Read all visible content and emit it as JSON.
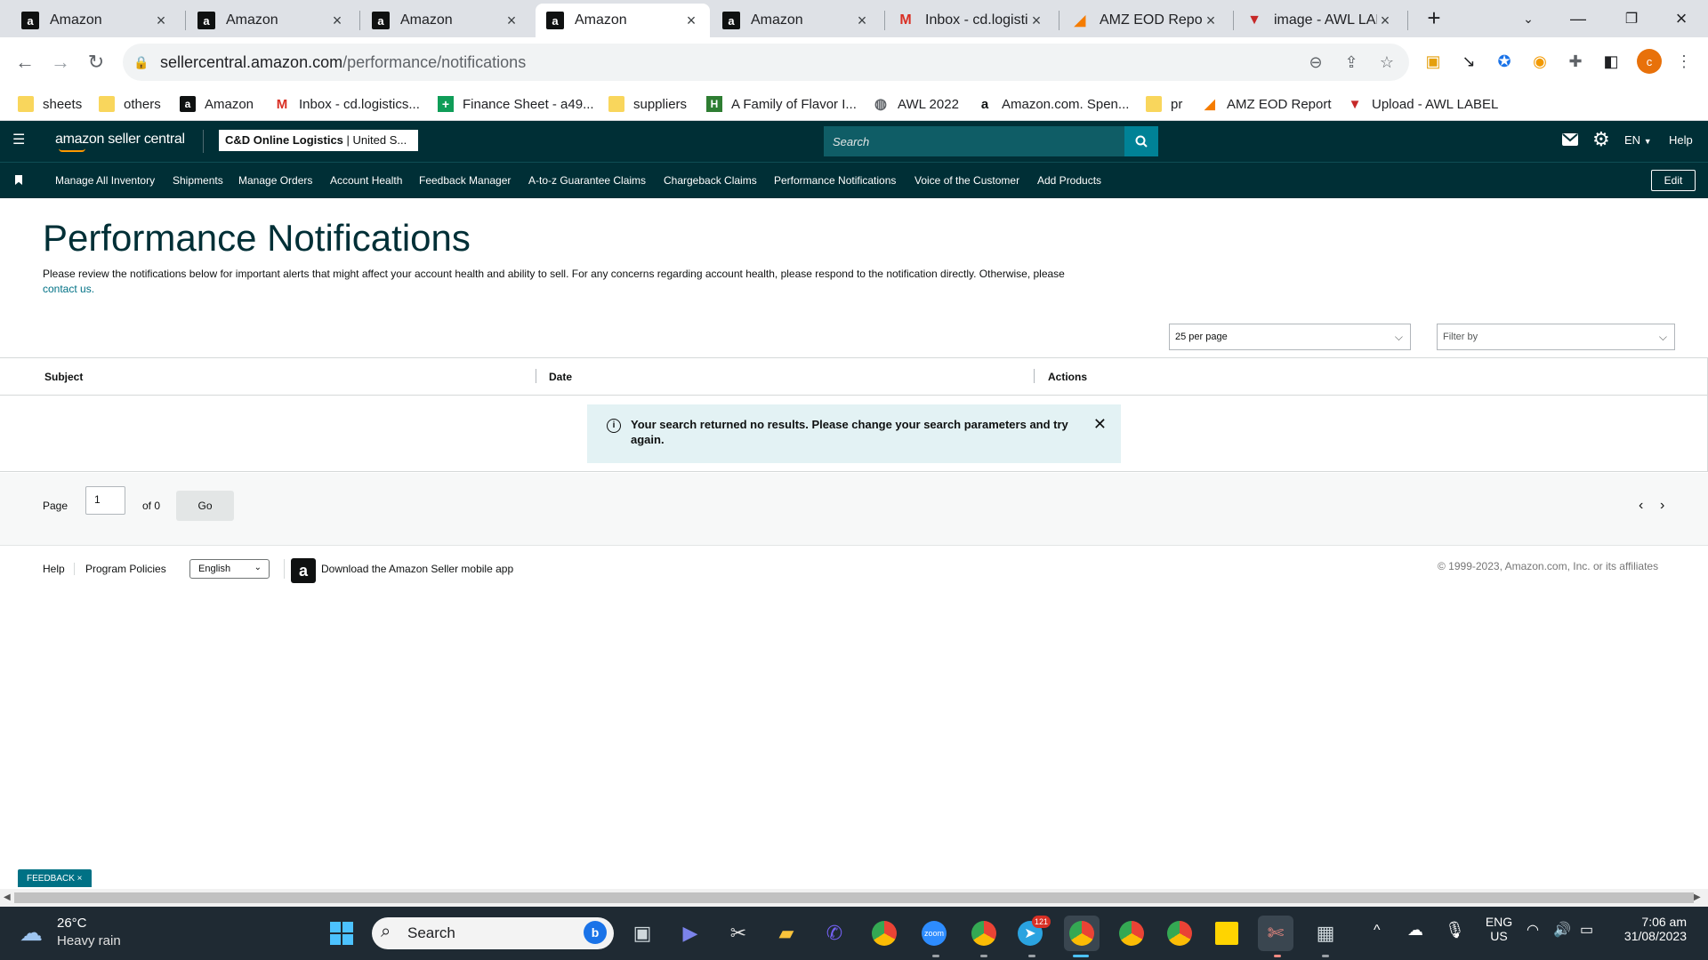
{
  "browser": {
    "tabs": [
      {
        "title": "Amazon",
        "icon": "amazon-icon"
      },
      {
        "title": "Amazon",
        "icon": "amazon-icon"
      },
      {
        "title": "Amazon",
        "icon": "amazon-icon"
      },
      {
        "title": "Amazon",
        "icon": "amazon-icon",
        "active": true
      },
      {
        "title": "Amazon",
        "icon": "amazon-icon"
      },
      {
        "title": "Inbox - cd.logistic",
        "icon": "gmail-icon"
      },
      {
        "title": "AMZ EOD Report",
        "icon": "report-icon"
      },
      {
        "title": "image - AWL LAB",
        "icon": "awl-icon"
      }
    ],
    "url_host": "sellercentral.amazon.com",
    "url_path": "/performance/notifications",
    "profile_initial": "c",
    "bookmarks": [
      "sheets",
      "others",
      "Amazon",
      "Inbox - cd.logistics...",
      "Finance Sheet - a49...",
      "suppliers",
      "A Family of Flavor I...",
      "AWL 2022",
      "Amazon.com. Spen...",
      "pr",
      "AMZ EOD Report",
      "Upload - AWL LABEL"
    ]
  },
  "header": {
    "logo": "amazon seller central",
    "account_bold": "C&D Online Logistics",
    "account_rest": " | United S...",
    "search_placeholder": "Search",
    "language": "EN",
    "help": "Help"
  },
  "nav": {
    "items": [
      "Manage All Inventory",
      "Shipments",
      "Manage Orders",
      "Account Health",
      "Feedback Manager",
      "A-to-z Guarantee Claims",
      "Chargeback Claims",
      "Performance Notifications",
      "Voice of the Customer",
      "Add Products"
    ],
    "edit": "Edit"
  },
  "main": {
    "title": "Performance Notifications",
    "description": "Please review the notifications below for important alerts that might affect your account health and ability to sell. For any concerns regarding account health, please respond to the notification directly. Otherwise, please",
    "contact_link": "contact us.",
    "per_page": "25 per page",
    "filter_by": "Filter by",
    "columns": [
      "Subject",
      "Date",
      "Actions"
    ],
    "alert": "Your search returned no results. Please change your search parameters and try again.",
    "pager": {
      "label": "Page",
      "value": "1",
      "of": "of 0",
      "go": "Go"
    }
  },
  "footer": {
    "help": "Help",
    "policies": "Program Policies",
    "language": "English",
    "app": "Download the Amazon Seller mobile app",
    "copyright": "© 1999-2023, Amazon.com, Inc. or its affiliates"
  },
  "feedback": "FEEDBACK ×",
  "taskbar": {
    "temp": "26°C",
    "weather": "Heavy rain",
    "search": "Search",
    "telegram_badge": "121",
    "lang": "ENG",
    "region": "US",
    "time": "7:06 am",
    "date": "31/08/2023"
  },
  "colors": {
    "header_bg": "#002f36",
    "search_button": "#008296",
    "link": "#007185",
    "alert_bg": "#e3f2f4"
  }
}
